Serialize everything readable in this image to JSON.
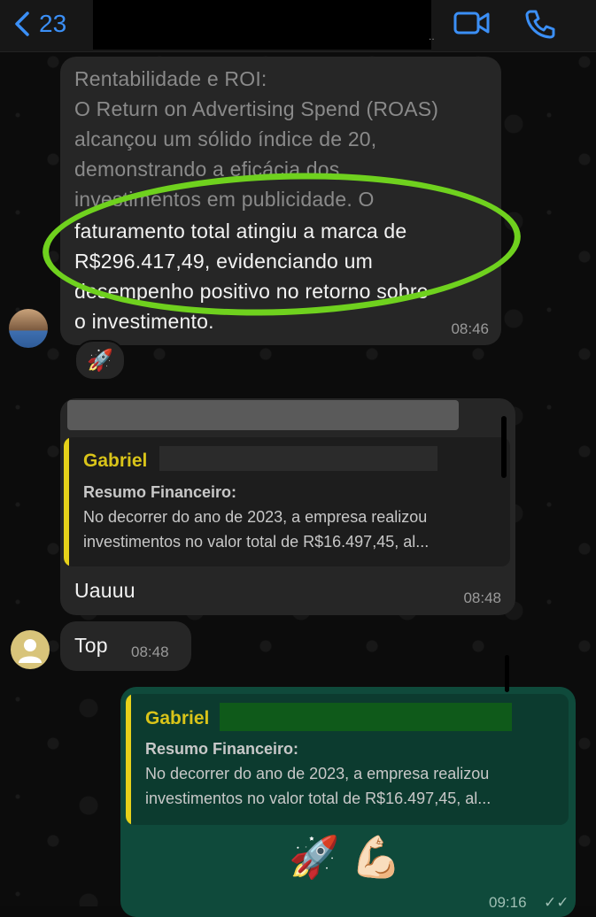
{
  "header": {
    "back_count": "23",
    "icons": {
      "back": "chevron-left-icon",
      "video": "video-camera-icon",
      "call": "phone-icon"
    },
    "accent_color": "#3b8ff6"
  },
  "messages": {
    "roi": {
      "lines": [
        "Rentabilidade e ROI:",
        "O Return on Advertising Spend (ROAS)",
        "alcançou um sólido índice de 20,",
        "demonstrando a eficácia dos",
        "investimentos em publicidade. O",
        "faturamento total atingiu a marca de",
        "R$296.417,49, evidenciando um",
        "desempenho positivo no retorno sobre",
        "o investimento."
      ],
      "time": "08:46",
      "reaction": "🚀"
    },
    "reply1": {
      "quote_name": "Gabriel",
      "quote_title": "Resumo Financeiro:",
      "quote_line1": "No decorrer do ano de 2023, a empresa realizou",
      "quote_line2": "investimentos no valor total de R$16.497,45, al...",
      "text": "Uauuu",
      "time": "08:48"
    },
    "top": {
      "text": "Top",
      "time": "08:48"
    },
    "outgoing": {
      "quote_name": "Gabriel",
      "quote_title": "Resumo Financeiro:",
      "quote_line1": "No decorrer do ano de 2023, a empresa realizou",
      "quote_line2": "investimentos no valor total de R$16.497,45, al...",
      "emojis": "🚀 💪🏻",
      "time": "09:16"
    }
  },
  "colors": {
    "incoming_bubble": "#262626",
    "outgoing_bubble": "#0f4a3b",
    "quote_accent": "#e6d11a",
    "highlight_marker": "#6fd11e"
  }
}
